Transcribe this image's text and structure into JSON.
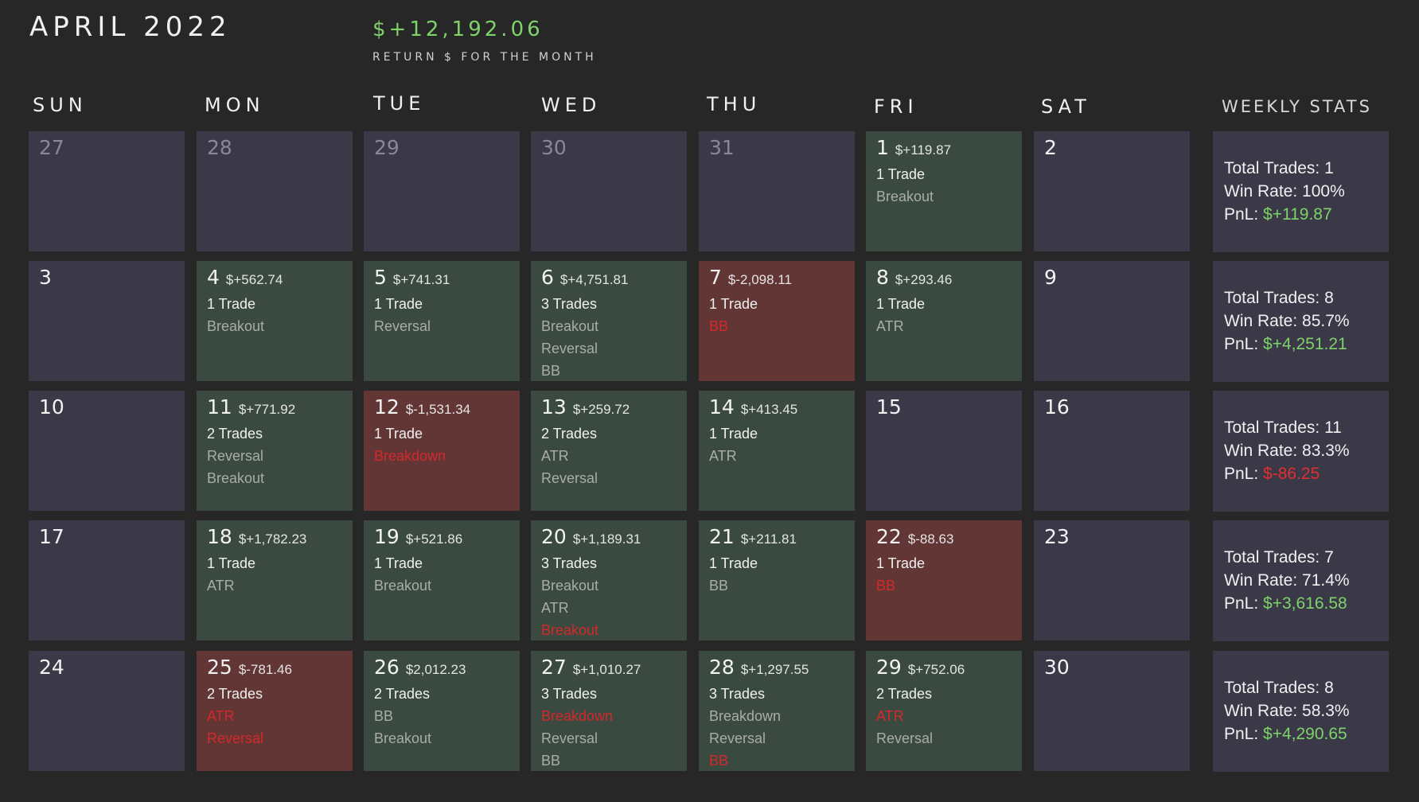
{
  "header": {
    "title": "APRIL 2022",
    "month_return": "$+12,192.06",
    "month_return_label": "RETURN $ FOR THE MONTH"
  },
  "weekdays": [
    "SUN",
    "MON",
    "TUE",
    "WED",
    "THU",
    "FRI",
    "SAT"
  ],
  "weekly_header": "WEEKLY STATS",
  "stats_labels": {
    "total": "Total Trades: ",
    "win": "Win Rate: ",
    "pnl": "PnL: "
  },
  "colors": {
    "green": "#7dd36a",
    "red": "#e0302f",
    "win_cell": "#3b4a40",
    "loss_cell": "#633636",
    "empty_cell": "#3b3848"
  },
  "weeks": [
    {
      "days": [
        {
          "day": "27",
          "muted": true
        },
        {
          "day": "28",
          "muted": true
        },
        {
          "day": "29",
          "muted": true
        },
        {
          "day": "30",
          "muted": true
        },
        {
          "day": "31",
          "muted": true
        },
        {
          "day": "1",
          "pnl": "$+119.87",
          "trades": "1 Trade",
          "result": "win",
          "tags": [
            {
              "t": "Breakout"
            }
          ]
        },
        {
          "day": "2"
        }
      ],
      "stats": {
        "total": "1",
        "win": "100%",
        "pnl": "$+119.87",
        "pnl_positive": true
      }
    },
    {
      "days": [
        {
          "day": "3"
        },
        {
          "day": "4",
          "pnl": "$+562.74",
          "trades": "1 Trade",
          "result": "win",
          "tags": [
            {
              "t": "Breakout"
            }
          ]
        },
        {
          "day": "5",
          "pnl": "$+741.31",
          "trades": "1 Trade",
          "result": "win",
          "tags": [
            {
              "t": "Reversal"
            }
          ]
        },
        {
          "day": "6",
          "pnl": "$+4,751.81",
          "trades": "3 Trades",
          "result": "win",
          "tags": [
            {
              "t": "Breakout"
            },
            {
              "t": "Reversal"
            },
            {
              "t": "BB"
            }
          ]
        },
        {
          "day": "7",
          "pnl": "$-2,098.11",
          "trades": "1 Trade",
          "result": "loss",
          "tags": [
            {
              "t": "BB",
              "red": true
            }
          ]
        },
        {
          "day": "8",
          "pnl": "$+293.46",
          "trades": "1 Trade",
          "result": "win",
          "tags": [
            {
              "t": "ATR"
            }
          ]
        },
        {
          "day": "9"
        }
      ],
      "stats": {
        "total": "8",
        "win": "85.7%",
        "pnl": "$+4,251.21",
        "pnl_positive": true
      }
    },
    {
      "days": [
        {
          "day": "10"
        },
        {
          "day": "11",
          "pnl": "$+771.92",
          "trades": "2 Trades",
          "result": "win",
          "tags": [
            {
              "t": "Reversal"
            },
            {
              "t": "Breakout"
            }
          ]
        },
        {
          "day": "12",
          "pnl": "$-1,531.34",
          "trades": "1 Trade",
          "result": "loss",
          "tags": [
            {
              "t": "Breakdown",
              "red": true
            }
          ]
        },
        {
          "day": "13",
          "pnl": "$+259.72",
          "trades": "2 Trades",
          "result": "win",
          "tags": [
            {
              "t": "ATR"
            },
            {
              "t": "Reversal"
            }
          ]
        },
        {
          "day": "14",
          "pnl": "$+413.45",
          "trades": "1 Trade",
          "result": "win",
          "tags": [
            {
              "t": "ATR"
            }
          ]
        },
        {
          "day": "15"
        },
        {
          "day": "16"
        }
      ],
      "stats": {
        "total": "11",
        "win": "83.3%",
        "pnl": "$-86.25",
        "pnl_positive": false
      }
    },
    {
      "days": [
        {
          "day": "17"
        },
        {
          "day": "18",
          "pnl": "$+1,782.23",
          "trades": "1 Trade",
          "result": "win",
          "tags": [
            {
              "t": "ATR"
            }
          ]
        },
        {
          "day": "19",
          "pnl": "$+521.86",
          "trades": "1 Trade",
          "result": "win",
          "tags": [
            {
              "t": "Breakout"
            }
          ]
        },
        {
          "day": "20",
          "pnl": "$+1,189.31",
          "trades": "3 Trades",
          "result": "win",
          "tags": [
            {
              "t": "Breakout"
            },
            {
              "t": "ATR"
            },
            {
              "t": "Breakout",
              "red": true
            }
          ]
        },
        {
          "day": "21",
          "pnl": "$+211.81",
          "trades": "1 Trade",
          "result": "win",
          "tags": [
            {
              "t": "BB"
            }
          ]
        },
        {
          "day": "22",
          "pnl": "$-88.63",
          "trades": "1 Trade",
          "result": "loss",
          "tags": [
            {
              "t": "BB",
              "red": true
            }
          ]
        },
        {
          "day": "23"
        }
      ],
      "stats": {
        "total": "7",
        "win": "71.4%",
        "pnl": "$+3,616.58",
        "pnl_positive": true
      }
    },
    {
      "days": [
        {
          "day": "24"
        },
        {
          "day": "25",
          "pnl": "$-781.46",
          "trades": "2 Trades",
          "result": "loss",
          "tags": [
            {
              "t": "ATR",
              "red": true
            },
            {
              "t": "Reversal",
              "red": true
            }
          ]
        },
        {
          "day": "26",
          "pnl": "$2,012.23",
          "trades": "2 Trades",
          "result": "win",
          "tags": [
            {
              "t": "BB"
            },
            {
              "t": "Breakout"
            }
          ]
        },
        {
          "day": "27",
          "pnl": "$+1,010.27",
          "trades": "3 Trades",
          "result": "win",
          "tags": [
            {
              "t": "Breakdown",
              "red": true
            },
            {
              "t": "Reversal"
            },
            {
              "t": "BB"
            }
          ]
        },
        {
          "day": "28",
          "pnl": "$+1,297.55",
          "trades": "3 Trades",
          "result": "win",
          "tags": [
            {
              "t": "Breakdown"
            },
            {
              "t": "Reversal"
            },
            {
              "t": "BB",
              "red": true
            }
          ]
        },
        {
          "day": "29",
          "pnl": "$+752.06",
          "trades": "2 Trades",
          "result": "win",
          "tags": [
            {
              "t": "ATR",
              "red": true
            },
            {
              "t": "Reversal"
            }
          ]
        },
        {
          "day": "30"
        }
      ],
      "stats": {
        "total": "8",
        "win": "58.3%",
        "pnl": "$+4,290.65",
        "pnl_positive": true
      }
    }
  ]
}
